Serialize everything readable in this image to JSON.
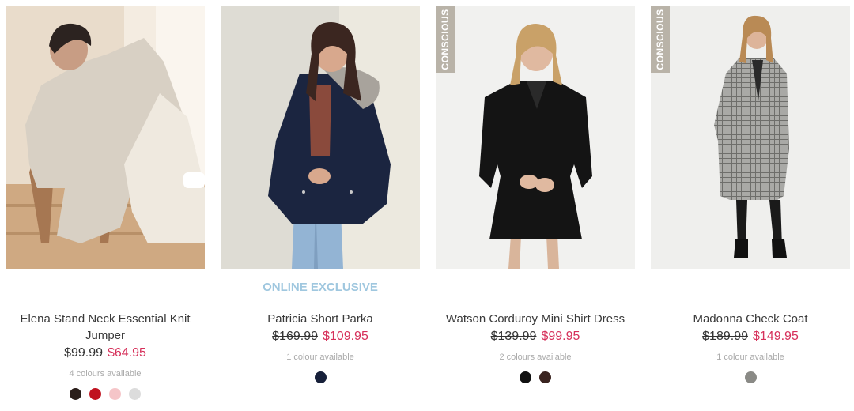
{
  "products": [
    {
      "badge": "",
      "name": "Elena Stand Neck Essential Knit Jumper",
      "was_price": "$99.99",
      "now_price": "$64.95",
      "availability": "4 colours available",
      "swatches": [
        "#2a1e1a",
        "#c0121f",
        "#f5c5c8",
        "#dcdcdc"
      ]
    },
    {
      "badge": "ONLINE EXCLUSIVE",
      "name": "Patricia Short Parka",
      "was_price": "$169.99",
      "now_price": "$109.95",
      "availability": "1 colour available",
      "swatches": [
        "#17203a"
      ]
    },
    {
      "badge": "",
      "tag": "CONSCIOUS",
      "name": "Watson Corduroy Mini Shirt Dress",
      "was_price": "$139.99",
      "now_price": "$99.95",
      "availability": "2 colours available",
      "swatches": [
        "#111111",
        "#3a2420"
      ]
    },
    {
      "badge": "",
      "tag": "CONSCIOUS",
      "name": "Madonna Check Coat",
      "was_price": "$189.99",
      "now_price": "$149.95",
      "availability": "1 colour available",
      "swatches": [
        "#8a8a86"
      ]
    }
  ],
  "colors": {
    "sale_price": "#d6305a",
    "exclusive": "#9fc7df",
    "tag_bg": "#b9b3a8"
  }
}
